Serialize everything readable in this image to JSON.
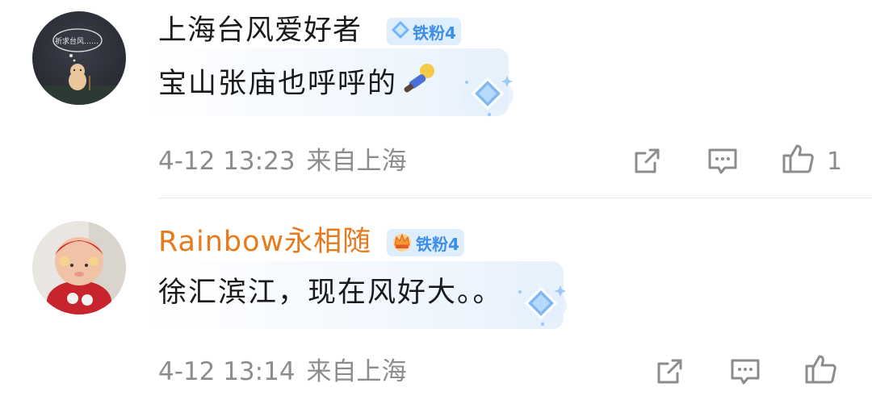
{
  "comments": [
    {
      "username": "上海台风爱好者",
      "username_color": "#1a1a1a",
      "badge_label": "铁粉4",
      "badge_icon": "diamond-icon",
      "content": "宝山张庙也呼呼的",
      "emoji": "blowing-person-emoji",
      "date": "4-12 13:23",
      "location": "来自上海",
      "like_count": "1",
      "avatar_caption": "祈求台风……"
    },
    {
      "username": "Rainbow永相随",
      "username_color": "#e87a1e",
      "badge_label": "铁粉4",
      "badge_icon": "crown-icon",
      "content": "徐汇滨江，现在风好大。。",
      "date": "4-12 13:14",
      "location": "来自上海",
      "like_count": ""
    }
  ],
  "colors": {
    "meta_text": "#8c8c8c",
    "badge_text": "#3d8ee8",
    "badge_bg": "#dfeefc",
    "bubble_bg": "#eef6fd"
  }
}
